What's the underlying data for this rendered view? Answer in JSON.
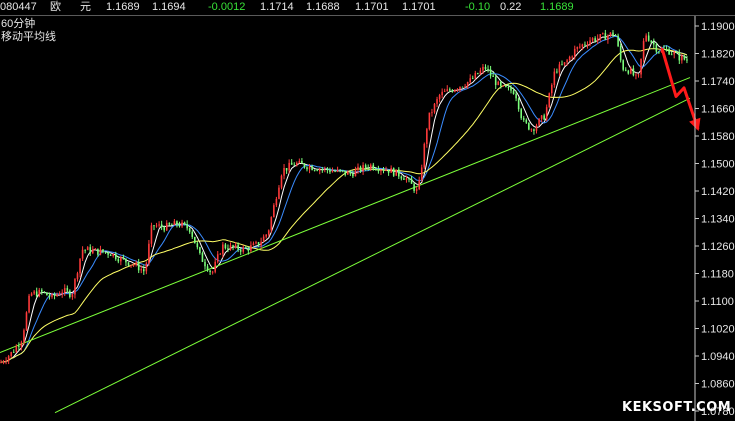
{
  "header": {
    "code": "080447",
    "name1": "欧",
    "name2": "元",
    "fields": [
      "1.1689",
      "1.1694",
      "-0.0012",
      "1.1714",
      "1.1688",
      "1.1701",
      "1.1701",
      "-0.10",
      "0.22",
      "1.1689"
    ]
  },
  "chart_title": "60分钟",
  "indicator_label": "移动平均线",
  "watermark": "KEKSOFT.COM",
  "chart_data": {
    "type": "candlestick",
    "ylim": [
      1.076,
      1.194
    ],
    "yticks": [
      "1.1900",
      "1.1820",
      "1.1740",
      "1.1660",
      "1.1580",
      "1.1500",
      "1.1420",
      "1.1340",
      "1.1260",
      "1.1180",
      "1.1100",
      "1.1020",
      "1.0940",
      "1.0860",
      "1.0780"
    ],
    "price_path": [
      [
        0,
        1.092
      ],
      [
        12,
        1.095
      ],
      [
        22,
        1.099
      ],
      [
        30,
        1.112
      ],
      [
        42,
        1.1125
      ],
      [
        52,
        1.111
      ],
      [
        62,
        1.113
      ],
      [
        72,
        1.112
      ],
      [
        82,
        1.125
      ],
      [
        95,
        1.1245
      ],
      [
        110,
        1.124
      ],
      [
        122,
        1.122
      ],
      [
        135,
        1.1205
      ],
      [
        145,
        1.1185
      ],
      [
        152,
        1.132
      ],
      [
        165,
        1.1315
      ],
      [
        178,
        1.1325
      ],
      [
        190,
        1.131
      ],
      [
        200,
        1.123
      ],
      [
        212,
        1.118
      ],
      [
        222,
        1.126
      ],
      [
        232,
        1.1255
      ],
      [
        245,
        1.125
      ],
      [
        258,
        1.1265
      ],
      [
        268,
        1.13
      ],
      [
        282,
        1.148
      ],
      [
        295,
        1.15
      ],
      [
        312,
        1.149
      ],
      [
        330,
        1.148
      ],
      [
        350,
        1.147
      ],
      [
        370,
        1.1495
      ],
      [
        390,
        1.148
      ],
      [
        405,
        1.146
      ],
      [
        418,
        1.1415
      ],
      [
        428,
        1.163
      ],
      [
        440,
        1.17
      ],
      [
        455,
        1.172
      ],
      [
        470,
        1.174
      ],
      [
        485,
        1.178
      ],
      [
        500,
        1.172
      ],
      [
        515,
        1.171
      ],
      [
        523,
        1.162
      ],
      [
        532,
        1.16
      ],
      [
        545,
        1.164
      ],
      [
        555,
        1.177
      ],
      [
        565,
        1.179
      ],
      [
        575,
        1.183
      ],
      [
        590,
        1.186
      ],
      [
        605,
        1.187
      ],
      [
        615,
        1.188
      ],
      [
        622,
        1.178
      ],
      [
        630,
        1.177
      ],
      [
        638,
        1.174
      ],
      [
        645,
        1.188
      ],
      [
        658,
        1.183
      ],
      [
        668,
        1.183
      ],
      [
        678,
        1.181
      ],
      [
        688,
        1.18
      ]
    ],
    "trendlines": [
      {
        "from": [
          0,
          1.095
        ],
        "to": [
          690,
          1.175
        ]
      },
      {
        "from": [
          55,
          1.0775
        ],
        "to": [
          690,
          1.169
        ]
      }
    ],
    "arrow": [
      [
        662,
        1.1835
      ],
      [
        676,
        1.1695
      ],
      [
        684,
        1.172
      ],
      [
        698,
        1.16
      ]
    ]
  }
}
